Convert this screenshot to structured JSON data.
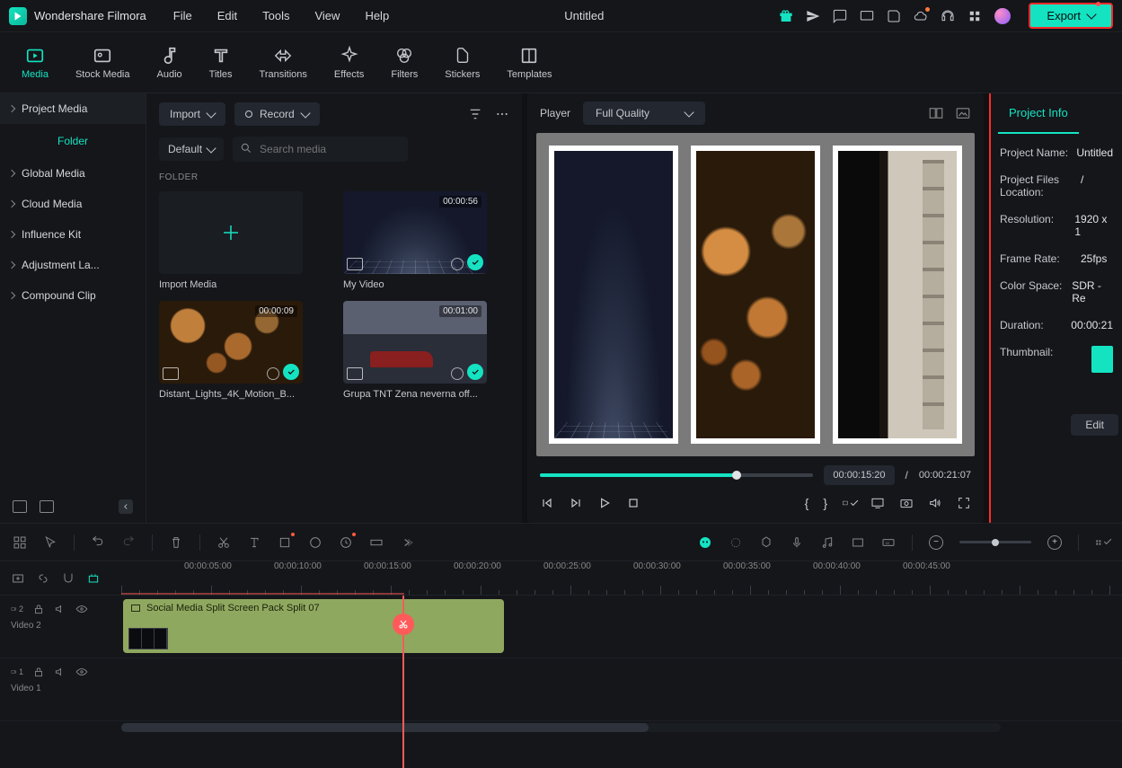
{
  "app": {
    "name": "Wondershare Filmora",
    "docTitle": "Untitled"
  },
  "menu": [
    "File",
    "Edit",
    "Tools",
    "View",
    "Help"
  ],
  "export": "Export",
  "tabs": [
    {
      "label": "Media",
      "active": true
    },
    {
      "label": "Stock Media"
    },
    {
      "label": "Audio"
    },
    {
      "label": "Titles"
    },
    {
      "label": "Transitions"
    },
    {
      "label": "Effects"
    },
    {
      "label": "Filters"
    },
    {
      "label": "Stickers"
    },
    {
      "label": "Templates"
    }
  ],
  "sidebar": {
    "top": "Project Media",
    "folder": "Folder",
    "items": [
      "Global Media",
      "Cloud Media",
      "Influence Kit",
      "Adjustment La...",
      "Compound Clip"
    ]
  },
  "mediaPanel": {
    "import": "Import",
    "record": "Record",
    "sort": "Default",
    "searchPlaceholder": "Search media",
    "folderLabel": "FOLDER",
    "items": [
      {
        "title": "Import Media",
        "type": "import"
      },
      {
        "title": "My Video",
        "dur": "00:00:56",
        "check": true,
        "thumb": "moon"
      },
      {
        "title": "Distant_Lights_4K_Motion_B...",
        "dur": "00:00:09",
        "check": true,
        "thumb": "bokeh"
      },
      {
        "title": "Grupa TNT Zena neverna off...",
        "dur": "00:01:00",
        "check": true,
        "thumb": "car"
      }
    ]
  },
  "player": {
    "label": "Player",
    "quality": "Full Quality",
    "current": "00:00:15:20",
    "total": "00:00:21:07"
  },
  "info": {
    "tab": "Project Info",
    "rows": [
      {
        "label": "Project Name:",
        "value": "Untitled"
      },
      {
        "label": "Project Files Location:",
        "value": "/"
      },
      {
        "label": "Resolution:",
        "value": "1920 x 1"
      },
      {
        "label": "Frame Rate:",
        "value": "25fps"
      },
      {
        "label": "Color Space:",
        "value": "SDR - Re"
      },
      {
        "label": "Duration:",
        "value": "00:00:21"
      },
      {
        "label": "Thumbnail:",
        "value": ""
      }
    ],
    "edit": "Edit"
  },
  "timeline": {
    "marks": [
      "00:00:05:00",
      "00:00:10:00",
      "00:00:15:00",
      "00:00:20:00",
      "00:00:25:00",
      "00:00:30:00",
      "00:00:35:00",
      "00:00:40:00",
      "00:00:45:00"
    ],
    "tracks": [
      {
        "name": "Video 2",
        "clip": "Social Media Split Screen Pack Split 07"
      },
      {
        "name": "Video 1"
      }
    ]
  }
}
